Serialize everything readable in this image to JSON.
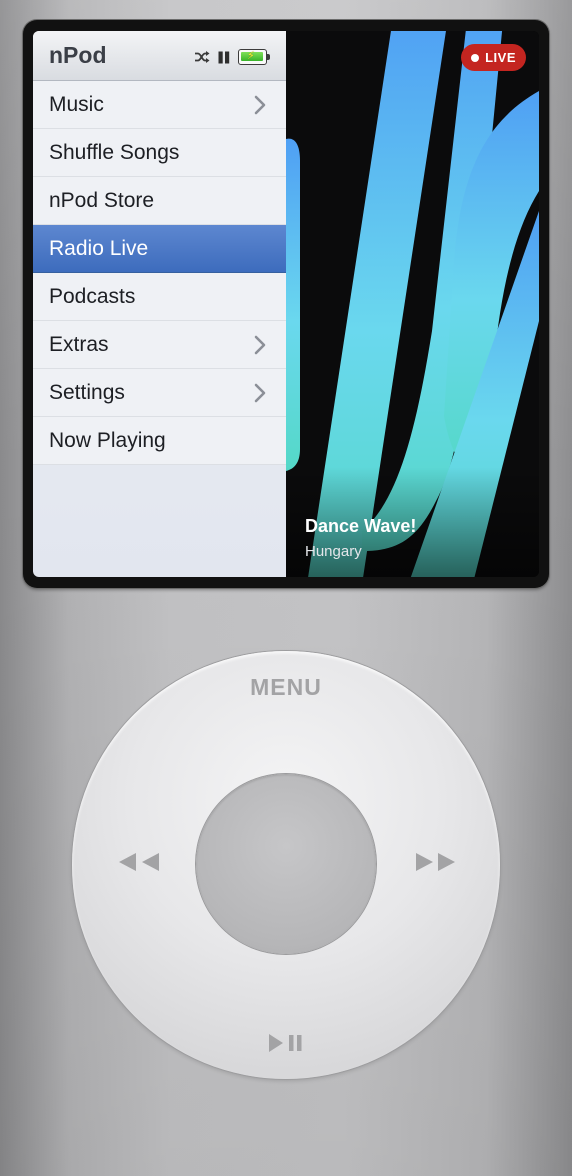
{
  "app": {
    "title": "nPod"
  },
  "status": {
    "shuffle_icon": "shuffle-icon",
    "playback_icon": "pause-icon",
    "battery_icon": "battery-charging-icon",
    "battery_level": 0.85,
    "battery_color": "#38b42a"
  },
  "menu": {
    "selected_index": 3,
    "items": [
      {
        "label": "Music",
        "has_submenu": true
      },
      {
        "label": "Shuffle Songs",
        "has_submenu": false
      },
      {
        "label": "nPod Store",
        "has_submenu": false
      },
      {
        "label": "Radio Live",
        "has_submenu": false
      },
      {
        "label": "Podcasts",
        "has_submenu": false
      },
      {
        "label": "Extras",
        "has_submenu": true
      },
      {
        "label": "Settings",
        "has_submenu": true
      },
      {
        "label": "Now Playing",
        "has_submenu": false
      }
    ]
  },
  "now_playing": {
    "badge": "LIVE",
    "badge_color": "#c42520",
    "station": "Dance Wave!",
    "country": "Hungary",
    "artwork_colors": [
      "#4f9ff4",
      "#6ad8ee",
      "#54d8c7"
    ]
  },
  "wheel": {
    "menu_label": "MENU",
    "left_icon": "rewind-icon",
    "right_icon": "fast-forward-icon",
    "bottom_icon": "play-pause-icon",
    "center": "select-button"
  },
  "colors": {
    "selection": "#4671c2",
    "wheel_glyph": "#a3a3a5"
  }
}
